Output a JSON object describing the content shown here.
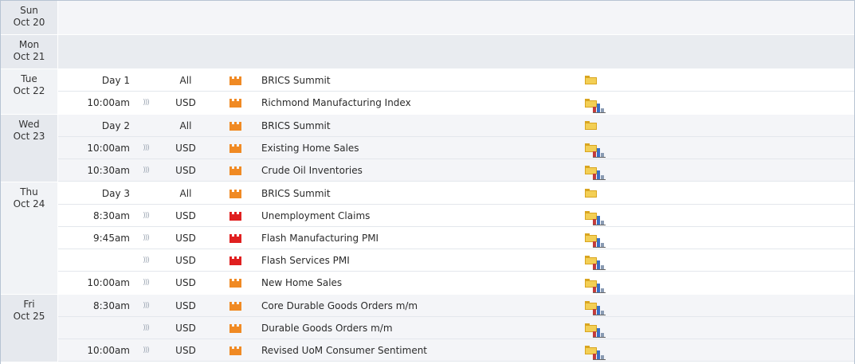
{
  "days": [
    {
      "day": "Sun",
      "date": "Oct 20",
      "events": []
    },
    {
      "day": "Mon",
      "date": "Oct 21",
      "events": []
    },
    {
      "day": "Tue",
      "date": "Oct 22",
      "events": [
        {
          "time": "Day 1",
          "signal": "",
          "currency": "All",
          "impact": "medium",
          "event": "BRICS Summit",
          "chart": false
        },
        {
          "time": "10:00am",
          "signal": ")))",
          "currency": "USD",
          "impact": "medium",
          "event": "Richmond Manufacturing Index",
          "chart": true
        }
      ]
    },
    {
      "day": "Wed",
      "date": "Oct 23",
      "events": [
        {
          "time": "Day 2",
          "signal": "",
          "currency": "All",
          "impact": "medium",
          "event": "BRICS Summit",
          "chart": false
        },
        {
          "time": "10:00am",
          "signal": ")))",
          "currency": "USD",
          "impact": "medium",
          "event": "Existing Home Sales",
          "chart": true
        },
        {
          "time": "10:30am",
          "signal": ")))",
          "currency": "USD",
          "impact": "medium",
          "event": "Crude Oil Inventories",
          "chart": true
        }
      ]
    },
    {
      "day": "Thu",
      "date": "Oct 24",
      "events": [
        {
          "time": "Day 3",
          "signal": "",
          "currency": "All",
          "impact": "medium",
          "event": "BRICS Summit",
          "chart": false
        },
        {
          "time": "8:30am",
          "signal": ")))",
          "currency": "USD",
          "impact": "high",
          "event": "Unemployment Claims",
          "chart": true
        },
        {
          "time": "9:45am",
          "signal": ")))",
          "currency": "USD",
          "impact": "high",
          "event": "Flash Manufacturing PMI",
          "chart": true
        },
        {
          "time": "",
          "signal": ")))",
          "currency": "USD",
          "impact": "high",
          "event": "Flash Services PMI",
          "chart": true
        },
        {
          "time": "10:00am",
          "signal": ")))",
          "currency": "USD",
          "impact": "medium",
          "event": "New Home Sales",
          "chart": true
        }
      ]
    },
    {
      "day": "Fri",
      "date": "Oct 25",
      "events": [
        {
          "time": "8:30am",
          "signal": ")))",
          "currency": "USD",
          "impact": "medium",
          "event": "Core Durable Goods Orders m/m",
          "chart": true
        },
        {
          "time": "",
          "signal": ")))",
          "currency": "USD",
          "impact": "medium",
          "event": "Durable Goods Orders m/m",
          "chart": true
        },
        {
          "time": "10:00am",
          "signal": ")))",
          "currency": "USD",
          "impact": "medium",
          "event": "Revised UoM Consumer Sentiment",
          "chart": true
        }
      ]
    }
  ],
  "colors": {
    "impact_medium": "#f08a24",
    "impact_high": "#e02020",
    "folder": "#f3cf55",
    "row_shade": "#f0f2f5",
    "date_cell": "#e6e9ee"
  },
  "icons": {
    "impact": "impact-folder-icon",
    "detail": "detail-folder-icon",
    "chart": "bar-chart-icon"
  }
}
